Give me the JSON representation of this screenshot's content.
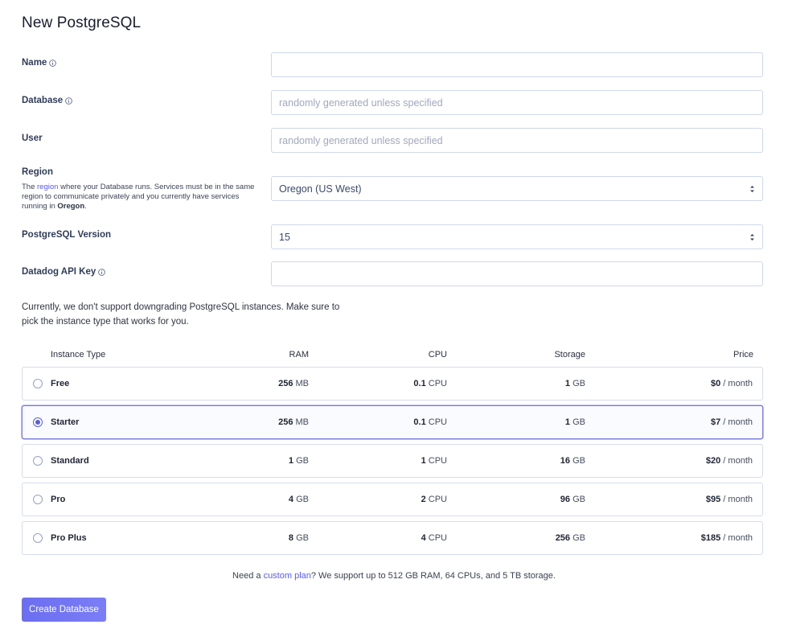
{
  "page": {
    "title": "New PostgreSQL"
  },
  "fields": {
    "name": {
      "label": "Name",
      "value": "",
      "placeholder": ""
    },
    "database": {
      "label": "Database",
      "value": "",
      "placeholder": "randomly generated unless specified"
    },
    "user": {
      "label": "User",
      "value": "",
      "placeholder": "randomly generated unless specified"
    },
    "region": {
      "label": "Region",
      "desc_prefix": "The ",
      "desc_link": "region",
      "desc_middle": " where your Database runs. Services must be in the same region to communicate privately and you currently have services running in ",
      "desc_bold": "Oregon",
      "desc_suffix": ".",
      "selected": "Oregon (US West)"
    },
    "version": {
      "label": "PostgreSQL Version",
      "selected": "15"
    },
    "datadog": {
      "label": "Datadog API Key",
      "value": "",
      "placeholder": ""
    }
  },
  "warning": "Currently, we don't support downgrading PostgreSQL instances. Make sure to pick the instance type that works for you.",
  "table": {
    "headers": {
      "instance_type": "Instance Type",
      "ram": "RAM",
      "cpu": "CPU",
      "storage": "Storage",
      "price": "Price"
    },
    "rows": [
      {
        "name": "Free",
        "ram_value": "256",
        "ram_unit": " MB",
        "cpu_value": "0.1",
        "cpu_unit": " CPU",
        "storage_value": "1",
        "storage_unit": " GB",
        "price_value": "$0",
        "price_unit": " / month",
        "selected": false
      },
      {
        "name": "Starter",
        "ram_value": "256",
        "ram_unit": " MB",
        "cpu_value": "0.1",
        "cpu_unit": " CPU",
        "storage_value": "1",
        "storage_unit": " GB",
        "price_value": "$7",
        "price_unit": " / month",
        "selected": true
      },
      {
        "name": "Standard",
        "ram_value": "1",
        "ram_unit": " GB",
        "cpu_value": "1",
        "cpu_unit": " CPU",
        "storage_value": "16",
        "storage_unit": " GB",
        "price_value": "$20",
        "price_unit": " / month",
        "selected": false
      },
      {
        "name": "Pro",
        "ram_value": "4",
        "ram_unit": " GB",
        "cpu_value": "2",
        "cpu_unit": " CPU",
        "storage_value": "96",
        "storage_unit": " GB",
        "price_value": "$95",
        "price_unit": " / month",
        "selected": false
      },
      {
        "name": "Pro Plus",
        "ram_value": "8",
        "ram_unit": " GB",
        "cpu_value": "4",
        "cpu_unit": " CPU",
        "storage_value": "256",
        "storage_unit": " GB",
        "price_value": "$185",
        "price_unit": " / month",
        "selected": false
      }
    ]
  },
  "footnote": {
    "prefix": "Need a ",
    "link": "custom plan",
    "suffix": "? We support up to 512 GB RAM, 64 CPUs, and 5 TB storage."
  },
  "actions": {
    "create_label": "Create Database"
  },
  "icons": {
    "info": "info-icon",
    "select": "chevron-updown-icon"
  },
  "colors": {
    "accent": "#5b5ce8",
    "button": "#6b6ef0",
    "border": "#cfd8ea"
  }
}
